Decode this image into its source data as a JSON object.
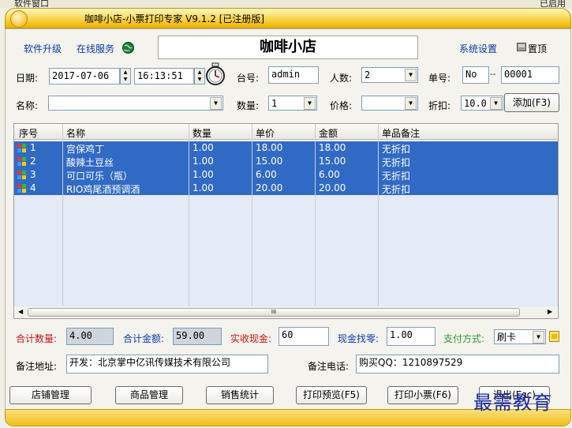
{
  "outer_title": {
    "left": "软件窗口",
    "right": "已启用"
  },
  "title": "咖啡小店-小票打印专家 V9.1.2 [已注册版]",
  "top_links": {
    "upgrade": "软件升级",
    "online": "在线服务",
    "settings": "系统设置",
    "pin": "置顶"
  },
  "shop_name": "咖啡小店",
  "row1": {
    "date_label": "日期:",
    "date": "2017-07-06",
    "time": "16:13:51",
    "table_label": "台号:",
    "table": "admin",
    "people_label": "人数:",
    "people": "2",
    "order_label": "单号:",
    "order_prefix": "No",
    "order_sep": "--",
    "order_no": "00001"
  },
  "row2": {
    "name_label": "名称:",
    "name": "",
    "qty_label": "数量:",
    "qty": "1",
    "price_label": "价格:",
    "price": "",
    "discount_label": "折扣:",
    "discount": "10.0",
    "add_button": "添加(F3)"
  },
  "table": {
    "columns": [
      "序号",
      "名称",
      "数量",
      "单价",
      "金额",
      "单品备注"
    ],
    "rows": [
      {
        "no": "1",
        "name": "宫保鸡丁",
        "qty": "1.00",
        "price": "18.00",
        "amount": "18.00",
        "note": "无折扣"
      },
      {
        "no": "2",
        "name": "酸辣土豆丝",
        "qty": "1.00",
        "price": "15.00",
        "amount": "15.00",
        "note": "无折扣"
      },
      {
        "no": "3",
        "name": "可口可乐（瓶）",
        "qty": "1.00",
        "price": "6.00",
        "amount": "6.00",
        "note": "无折扣"
      },
      {
        "no": "4",
        "name": "RIO鸡尾酒预调酒",
        "qty": "1.00",
        "price": "20.00",
        "amount": "20.00",
        "note": "无折扣"
      }
    ],
    "scroll_thumb": "III"
  },
  "summary": {
    "total_qty_label": "合计数量:",
    "total_qty": "4.00",
    "total_amount_label": "合计金额:",
    "total_amount": "59.00",
    "cash_label": "实收现金:",
    "cash": "60",
    "change_label": "现金找零:",
    "change": "1.00",
    "pay_label": "支付方式:",
    "pay": "刷卡"
  },
  "notes": {
    "address_label": "备注地址:",
    "address": "开发：北京掌中亿讯传媒技术有限公司",
    "phone_label": "备注电话:",
    "phone": "购买QQ：1210897529"
  },
  "buttons": {
    "shop": "店铺管理",
    "goods": "商品管理",
    "stats": "销售统计",
    "preview": "打印预览(F5)",
    "print": "打印小票(F6)",
    "exit": "退出(Esc)"
  },
  "watermark": "最需教育",
  "colors": {
    "selected_row": "#316ac5",
    "accent_blue": "#0a3aa8",
    "accent_red": "#d01010",
    "accent_green": "#2a9d2a"
  }
}
